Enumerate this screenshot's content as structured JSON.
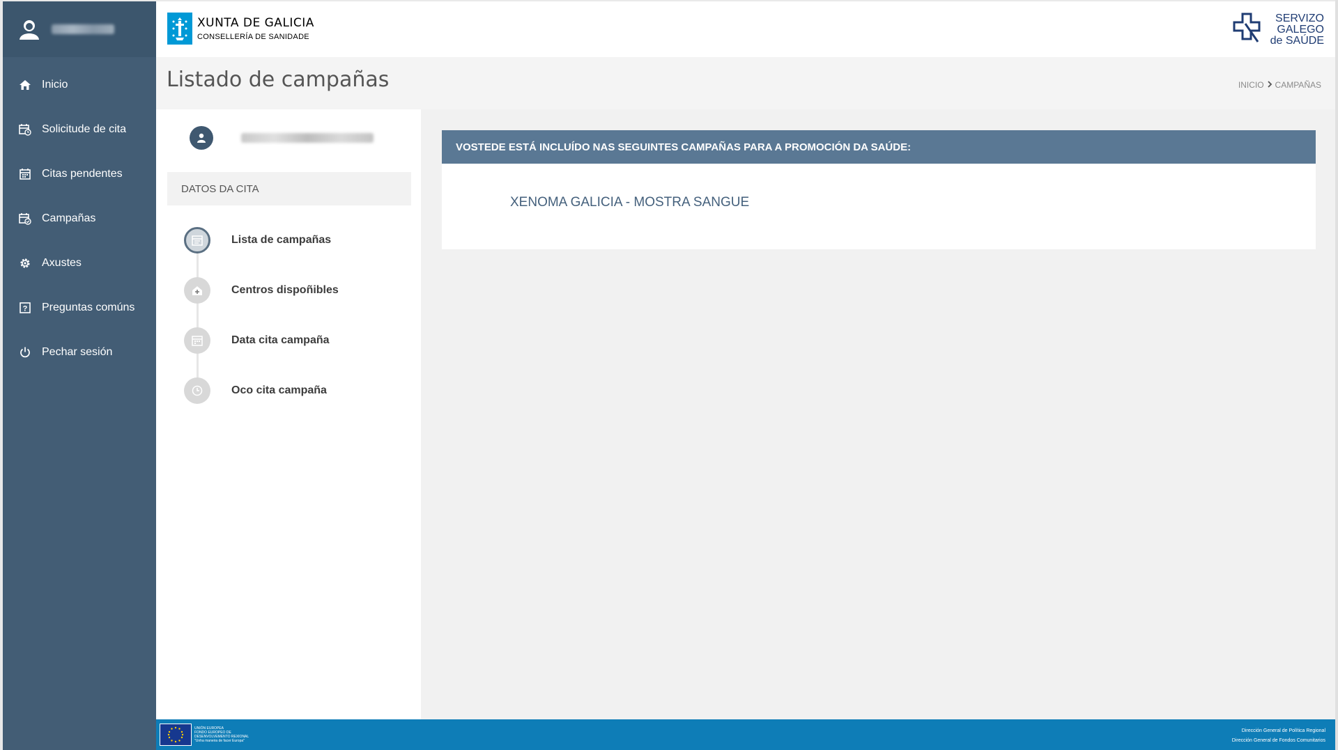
{
  "sidebar": {
    "items": [
      {
        "label": "Inicio",
        "icon": "home-icon"
      },
      {
        "label": "Solicitude de cita",
        "icon": "calendar-clock-icon"
      },
      {
        "label": "Citas pendentes",
        "icon": "calendar-icon"
      },
      {
        "label": "Campañas",
        "icon": "calendar-check-icon"
      },
      {
        "label": "Axustes",
        "icon": "gear-icon"
      },
      {
        "label": "Preguntas comúns",
        "icon": "question-icon"
      },
      {
        "label": "Pechar sesión",
        "icon": "power-icon"
      }
    ]
  },
  "header": {
    "xunta_title": "XUNTA DE GALICIA",
    "xunta_sub": "CONSELLERÍA DE SANIDADE",
    "sergas_line1": "SERVIZO",
    "sergas_line2": "GALEGO",
    "sergas_line3": "de SAÚDE"
  },
  "page": {
    "title": "Listado de campañas",
    "breadcrumb_home": "INICIO",
    "breadcrumb_current": "CAMPAÑAS"
  },
  "leftpanel": {
    "section_title": "DATOS DA CITA",
    "steps": [
      {
        "label": "Lista de campañas",
        "icon": "calendar-list-icon",
        "active": true
      },
      {
        "label": "Centros dispoñibles",
        "icon": "health-center-icon",
        "active": false
      },
      {
        "label": "Data cita campaña",
        "icon": "calendar-icon",
        "active": false
      },
      {
        "label": "Oco cita campaña",
        "icon": "clock-icon",
        "active": false
      }
    ]
  },
  "content": {
    "card_header": "VOSTEDE ESTÁ INCLUÍDO NAS SEGUINTES CAMPAÑAS PARA A PROMOCIÓN DA SAÚDE:",
    "campaigns": [
      "XENOMA GALICIA - MOSTRA SANGUE"
    ]
  },
  "footer": {
    "eu_line1": "UNIÓN EUROPEA",
    "eu_line2": "FONDO EUROPEO DE DESENVOLVEMENTO REXIONAL",
    "eu_line3": "\"Unha maneira de facer Europa\"",
    "right_line1": "Dirección General de Política Regional",
    "right_line2": "Dirección General de Fondos Comunitarios"
  },
  "colors": {
    "sidebar": "#435d75",
    "card_header": "#5a7894",
    "footer": "#0e7db7",
    "link": "#44607c"
  }
}
